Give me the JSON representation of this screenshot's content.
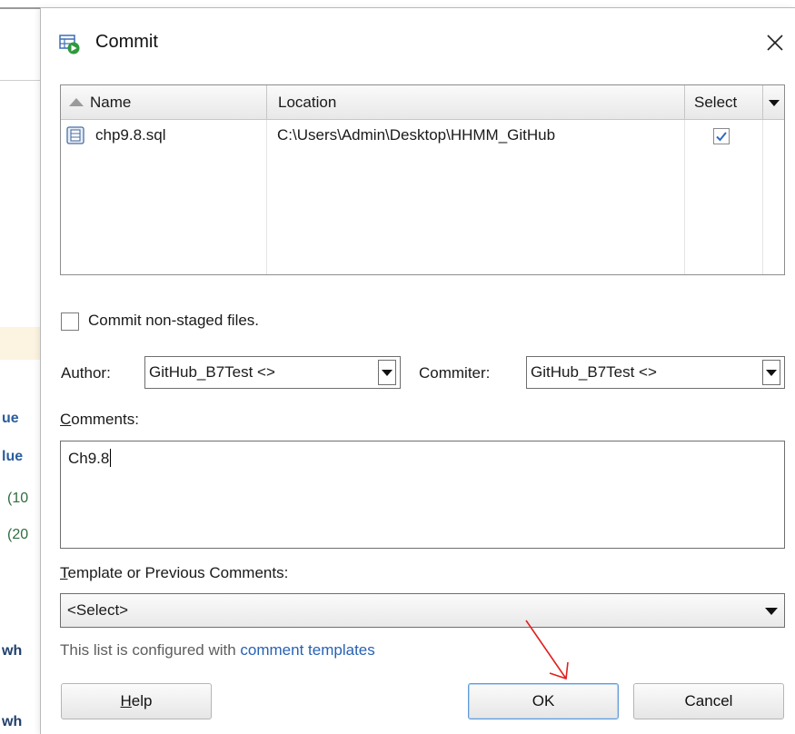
{
  "background_window": {
    "fragments": [
      "ue",
      "lue",
      "(10",
      "(20",
      "wh",
      "wh"
    ]
  },
  "dialog": {
    "title": "Commit",
    "table": {
      "columns": {
        "name": "Name",
        "location": "Location",
        "select": "Select"
      },
      "rows": [
        {
          "name": "chp9.8.sql",
          "location": "C:\\Users\\Admin\\Desktop\\HHMM_GitHub",
          "selected": true
        }
      ]
    },
    "commit_nonstaged": {
      "label": "Commit non-staged files.",
      "checked": false
    },
    "author": {
      "label": "Author:",
      "value": "GitHub_B7Test <>"
    },
    "committer": {
      "label": "Commiter:",
      "value": "GitHub_B7Test <>"
    },
    "comments": {
      "label_first": "C",
      "label_rest": "omments:",
      "value": "Ch9.8"
    },
    "template": {
      "label_first": "T",
      "label_rest": "emplate or Previous Comments:",
      "selected": "<Select>",
      "hint_prefix": "This list is configured with ",
      "hint_link": "comment templates"
    },
    "buttons": {
      "help_first": "H",
      "help_rest": "elp",
      "ok": "OK",
      "cancel": "Cancel"
    }
  },
  "colors": {
    "link": "#2762b3",
    "checkmark": "#2c6bc7",
    "ok_border": "#5f9bd6",
    "annotation_arrow": "#e02020"
  }
}
